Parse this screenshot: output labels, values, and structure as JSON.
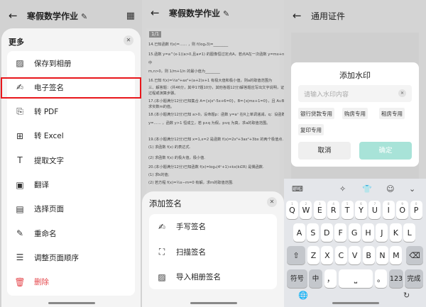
{
  "panel1": {
    "title": "寒假数学作业",
    "sheet_title": "更多",
    "items": [
      {
        "label": "保存到相册",
        "icon": "save-image-icon"
      },
      {
        "label": "电子签名",
        "icon": "signature-icon",
        "highlighted": true
      },
      {
        "label": "转 PDF",
        "icon": "pdf-icon"
      },
      {
        "label": "转 Excel",
        "icon": "excel-icon"
      },
      {
        "label": "提取文字",
        "icon": "text-extract-icon"
      },
      {
        "label": "翻译",
        "icon": "translate-icon"
      },
      {
        "label": "选择页面",
        "icon": "select-page-icon"
      },
      {
        "label": "重命名",
        "icon": "rename-icon"
      },
      {
        "label": "调整页面顺序",
        "icon": "reorder-icon"
      },
      {
        "label": "删除",
        "icon": "delete-icon",
        "color": "#e5484d"
      }
    ]
  },
  "panel2": {
    "title": "寒假数学作业",
    "page_badge": "1/1",
    "doc_lines": [
      "14.已知函数 f(x)=…… ，则 f(log₂3)=________",
      "15.函数 y=a^(x-1)(a>0,且a≠1) 的图像恒过定点A，若点A在一次函数 y=mx+n 的图像上，其",
      "中",
      "m,n>0，则 1/m+1/n 的最小值为________",
      "16.已知 f(x)=⅓x³+ax²+(a+2)x+1 有极大值和极小值，则a的取值范围为",
      "三、解答题：(共46分，其中17题10分，其他各题12分)解答题应写出文字说明，证明",
      "过程或演算步骤。",
      "17.(本小题满分12分)已知集合 A={x|x²-5x+6=0}，B={x|mx+1=0}，且 A∪B=A，",
      "求实数m的值。",
      "18.(本小题满分12分)已知 a>0，设命题p：函数 y=aˣ 在R上单调递减，q：设函数",
      "y=…… ，函数 y>1 恒成立，若 p∧q 为假，p∨q 为真，求a的取值范围。",
      "19.(本小题满分12分)已知 x=1,x=2 是函数 f(x)=2x³+3ax²+3bx 的两个极值点.",
      "(1) 求函数 f(x) 的表达式.",
      "(2) 求函数 f(x) 的极大值，极小值.",
      "20.(本小题满分12分)已知函数 f(x)=log₄(4ˣ+1)+kx(k∈R) 是偶函数.",
      "(1) 求k的值;",
      "(2) 若方程 f(x)=½x−m=0 有解，求m的取值范围."
    ],
    "sheet_title": "添加签名",
    "items": [
      {
        "label": "手写签名",
        "icon": "handwrite-icon"
      },
      {
        "label": "扫描签名",
        "icon": "scan-icon"
      },
      {
        "label": "导入相册签名",
        "icon": "gallery-icon"
      }
    ]
  },
  "panel3": {
    "title": "通用证件",
    "dialog": {
      "title": "添加水印",
      "placeholder": "请输入水印内容",
      "chips": [
        "银行贷款专用",
        "购房专用",
        "租房专用",
        "复印专用"
      ],
      "cancel": "取消",
      "confirm": "确定",
      "confirm_color": "#a8e3d8"
    },
    "keyboard": {
      "row1": [
        "Q",
        "W",
        "E",
        "R",
        "T",
        "Y",
        "U",
        "I",
        "O",
        "P"
      ],
      "row1_hints": [
        "1",
        "2",
        "3",
        "4",
        "5",
        "6",
        "7",
        "8",
        "9",
        "0"
      ],
      "row2": [
        "A",
        "S",
        "D",
        "F",
        "G",
        "H",
        "J",
        "K",
        "L"
      ],
      "row3": [
        "Z",
        "X",
        "C",
        "V",
        "B",
        "N",
        "M"
      ],
      "symbols": "符号",
      "chinese": "中",
      "comma": "，",
      "period": "。",
      "num": "123",
      "done": "完成"
    }
  }
}
